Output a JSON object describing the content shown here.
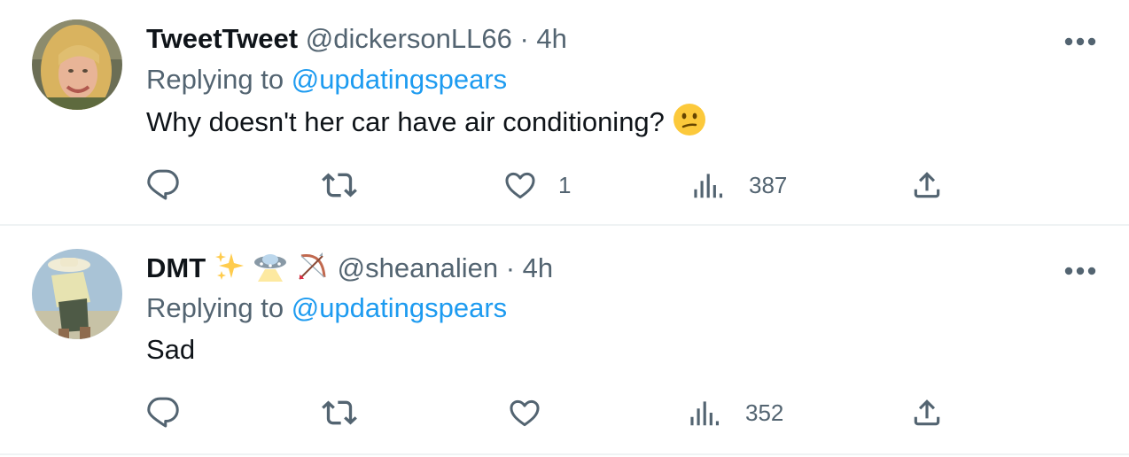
{
  "tweets": [
    {
      "name": "TweetTweet",
      "handle": "@dickersonLL66",
      "separator": "·",
      "time": "4h",
      "replying_prefix": "Replying to",
      "replying_to": "@updatingspears",
      "text": "Why doesn't her car have air conditioning?",
      "text_emoji": "confused-face",
      "replies": "",
      "retweets": "",
      "likes": "1",
      "views": "387"
    },
    {
      "name": "DMT",
      "name_emojis": [
        "sparkles",
        "flying-saucer",
        "bow-and-arrow"
      ],
      "handle": "@sheanalien",
      "separator": "·",
      "time": "4h",
      "replying_prefix": "Replying to",
      "replying_to": "@updatingspears",
      "text": "Sad",
      "replies": "",
      "retweets": "",
      "likes": "",
      "views": "352"
    }
  ],
  "colors": {
    "text": "#0f1419",
    "secondary": "#536471",
    "link": "#1d9bf0",
    "divider": "#eff3f4"
  }
}
